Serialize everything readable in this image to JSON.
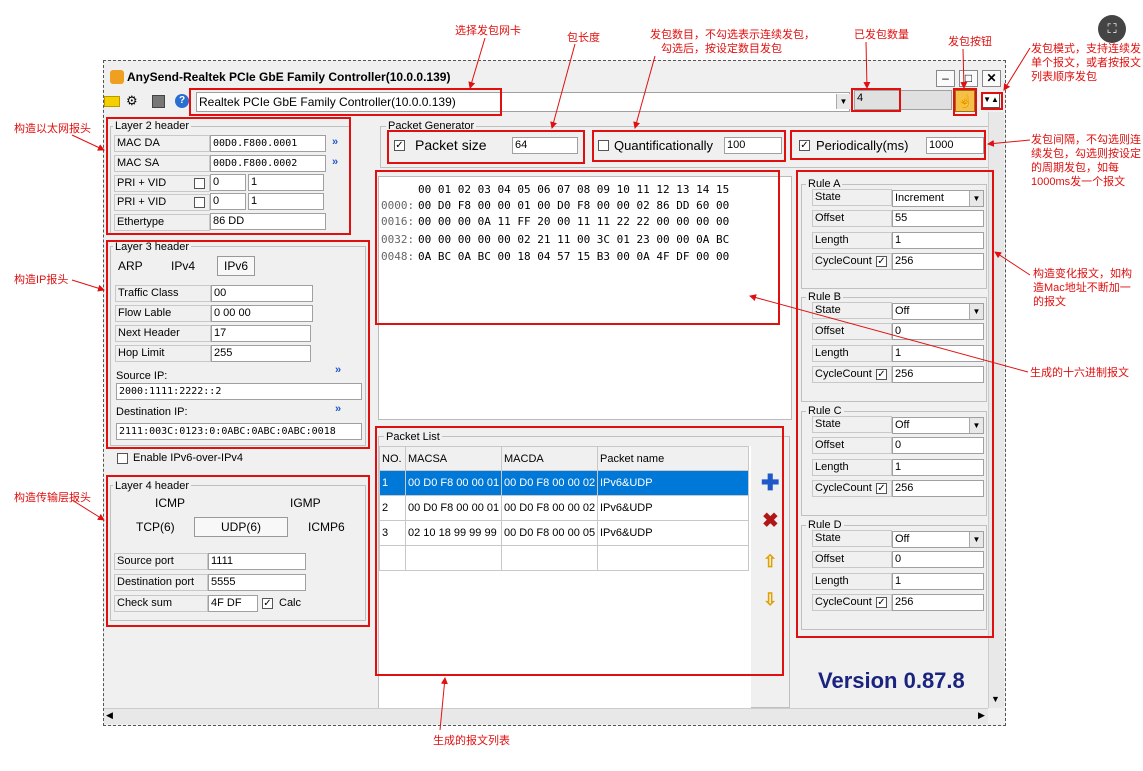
{
  "window": {
    "title": "AnySend-Realtek PCIe GbE Family Controller(10.0.0.139)",
    "nic": "Realtek PCIe GbE Family Controller(10.0.0.139)",
    "sent_count": "4",
    "version": "Version 0.87.8"
  },
  "annotations": {
    "nic": "选择发包网卡",
    "plen": "包长度",
    "count": "发包数目，不勾选表示连续发包，",
    "count2": "勾选后，按设定数目发包",
    "sent": "已发包数量",
    "sendbtn": "发包按钮",
    "mode": "发包模式，支持连续发单个报文，或者按报文列表顺序发包",
    "period": "发包间隔，不勾选则连续发包，勾选则按设定的周期发包，如每1000ms发一个报文",
    "eth": "构造以太网报头",
    "ip": "构造IP报头",
    "l4": "构造传输层报头",
    "rule": "构造变化报文，如构造Mac地址不断加一的报文",
    "hex": "生成的十六进制报文",
    "list": "生成的报文列表"
  },
  "l2": {
    "title": "Layer 2 header",
    "mac_da_label": "MAC DA",
    "mac_da": "00D0.F800.0001",
    "mac_sa_label": "MAC SA",
    "mac_sa": "00D0.F800.0002",
    "pri_vid_label": "PRI + VID",
    "pri1": "0",
    "vid1": "1",
    "pri2": "0",
    "vid2": "1",
    "ethertype_label": "Ethertype",
    "ethertype": "86 DD"
  },
  "l3": {
    "title": "Layer 3 header",
    "tabs": [
      "ARP",
      "IPv4",
      "IPv6"
    ],
    "traffic_class_label": "Traffic Class",
    "traffic_class": "00",
    "flow_label_label": "Flow Lable",
    "flow_label": "0 00 00",
    "next_header_label": "Next Header",
    "next_header": "17",
    "hop_limit_label": "Hop Limit",
    "hop_limit": "255",
    "src_label": "Source IP:",
    "src": "2000:1111:2222::2",
    "dst_label": "Destination IP:",
    "dst": "2111:003C:0123:0:0ABC:0ABC:0ABC:0018",
    "enable_label": "Enable IPv6-over-IPv4"
  },
  "l4": {
    "title": "Layer 4 header",
    "tabs": [
      "ICMP",
      "IGMP",
      "TCP(6)",
      "UDP(6)",
      "ICMP6"
    ],
    "sport_label": "Source port",
    "sport": "1111",
    "dport_label": "Destination port",
    "dport": "5555",
    "checksum_label": "Check sum",
    "checksum": "4F DF",
    "calc_label": "Calc"
  },
  "gen": {
    "title": "Packet Generator",
    "size_label": "Packet size",
    "size": "64",
    "quant_label": "Quantificationally",
    "quant": "100",
    "period_label": "Periodically(ms)",
    "period": "1000"
  },
  "hex": {
    "header": "00 01 02 03 04 05 06 07 08 09 10 11 12 13 14 15",
    "offsets": [
      "0000:",
      "0016:",
      "0032:",
      "0048:"
    ],
    "rows": [
      "00 D0 F8 00 00 01 00 D0 F8 00 00 02 86 DD 60 00",
      "00 00 00 0A 11 FF 20 00 11 11 22 22 00 00 00 00",
      "00 00 00 00 00 02 21 11 00 3C 01 23 00 00 0A BC",
      "0A BC 0A BC 00 18 04 57 15 B3 00 0A 4F DF 00 00"
    ]
  },
  "plist": {
    "title": "Packet List",
    "cols": [
      "NO.",
      "MACSA",
      "MACDA",
      "Packet name"
    ],
    "rows": [
      [
        "1",
        "00 D0 F8 00 00 01",
        "00 D0 F8 00 00 02",
        "IPv6&UDP"
      ],
      [
        "2",
        "00 D0 F8 00 00 01",
        "00 D0 F8 00 00 02",
        "IPv6&UDP"
      ],
      [
        "3",
        "02 10 18 99 99 99",
        "00 D0 F8 00 00 05",
        "IPv6&UDP"
      ]
    ]
  },
  "rules": [
    {
      "title": "Rule A",
      "state": "Increment",
      "offset": "55",
      "length": "1",
      "cycle": "256"
    },
    {
      "title": "Rule B",
      "state": "Off",
      "offset": "0",
      "length": "1",
      "cycle": "256"
    },
    {
      "title": "Rule C",
      "state": "Off",
      "offset": "0",
      "length": "1",
      "cycle": "256"
    },
    {
      "title": "Rule D",
      "state": "Off",
      "offset": "0",
      "length": "1",
      "cycle": "256"
    }
  ],
  "rule_labels": {
    "state": "State",
    "offset": "Offset",
    "length": "Length",
    "cycle": "CycleCount"
  },
  "colors": {
    "annotation": "#e01010",
    "selected": "#0078d7",
    "version": "#1a237e"
  }
}
